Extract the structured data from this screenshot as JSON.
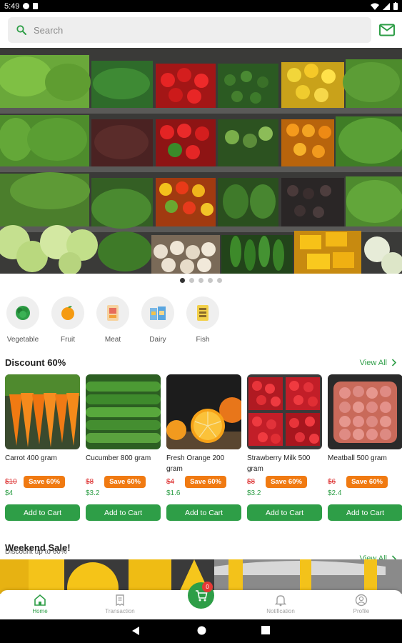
{
  "status_bar": {
    "time": "5:49"
  },
  "search": {
    "placeholder": "Search"
  },
  "banner": {
    "dot_count": 5,
    "active_index": 0
  },
  "categories": [
    {
      "label": "Vegetable",
      "icon": "broccoli-icon"
    },
    {
      "label": "Fruit",
      "icon": "orange-icon"
    },
    {
      "label": "Meat",
      "icon": "meat-icon"
    },
    {
      "label": "Dairy",
      "icon": "dairy-icon"
    },
    {
      "label": "Fish",
      "icon": "fish-icon"
    }
  ],
  "discount_section": {
    "title": "Discount 60%",
    "view_all": "View All"
  },
  "products": [
    {
      "name": "Carrot 400 gram",
      "old_price": "$10",
      "save": "Save 60%",
      "price": "$4",
      "button": "Add to Cart"
    },
    {
      "name": "Cucumber 800 gram",
      "old_price": "$8",
      "save": "Save 60%",
      "price": "$3.2",
      "button": "Add to Cart"
    },
    {
      "name": "Fresh Orange 200 gram",
      "old_price": "$4",
      "save": "Save 60%",
      "price": "$1.6",
      "button": "Add to Cart"
    },
    {
      "name": "Strawberry Milk 500 gram",
      "old_price": "$8",
      "save": "Save 60%",
      "price": "$3.2",
      "button": "Add to Cart"
    },
    {
      "name": "Meatball 500 gram",
      "old_price": "$6",
      "save": "Save 60%",
      "price": "$2.4",
      "button": "Add to Cart"
    }
  ],
  "weekend_section": {
    "title": "Weekend Sale!",
    "subtitle": "Discount up to 60%",
    "view_all": "View All"
  },
  "bottom_nav": {
    "home": "Home",
    "transaction": "Transaction",
    "notification": "Notification",
    "profile": "Profile",
    "cart_count": "0"
  },
  "colors": {
    "accent": "#2e9e47",
    "save_badge": "#f07a12",
    "old_price": "#dd3333",
    "badge": "#e53935"
  }
}
